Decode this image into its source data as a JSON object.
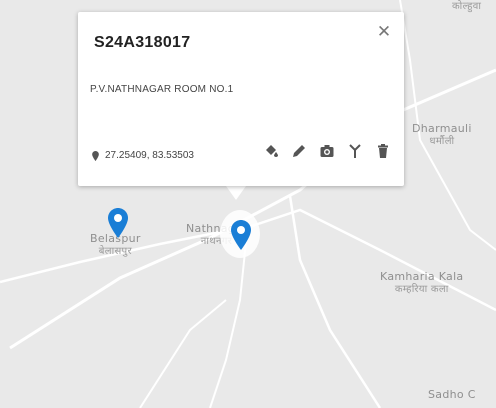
{
  "map": {
    "places": [
      {
        "name": "Belaspur",
        "name_hi": "बेलासपुर"
      },
      {
        "name": "Nathnagar",
        "name_hi": "नाथनगर"
      },
      {
        "name": "Dharmauli",
        "name_hi": "धर्मौली"
      },
      {
        "name": "Kamharia Kala",
        "name_hi": "कम्हरिया कला"
      },
      {
        "name": "Sadho C",
        "name_hi": ""
      },
      {
        "name": "",
        "name_hi": "कोल्हुवा"
      }
    ],
    "colors": {
      "background": "#e9e9e9",
      "road": "#ffffff",
      "marker": "#1a7ed6"
    }
  },
  "popup": {
    "title": "S24A318017",
    "address": "P.V.NATHNAGAR ROOM NO.1",
    "coords": "27.25409, 83.53503",
    "close_icon": "close-icon",
    "tools": [
      "fill-bucket-icon",
      "pencil-icon",
      "camera-icon",
      "antenna-icon",
      "trash-icon"
    ]
  }
}
